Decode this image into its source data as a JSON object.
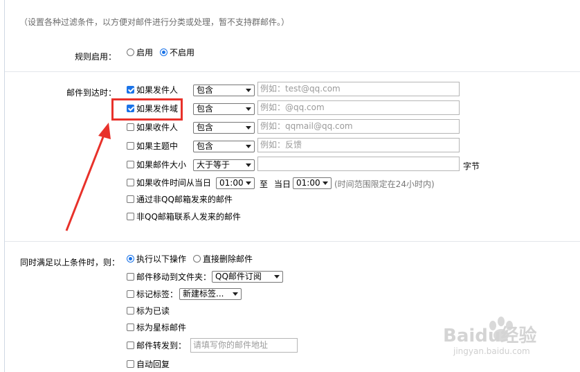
{
  "hint": "（设置各种过滤条件，以方便对邮件进行分类或处理，暂不支持群邮件。）",
  "rule_enable": {
    "label": "规则启用：",
    "on": "启用",
    "off": "不启用",
    "selected": "不启用"
  },
  "conditions": {
    "label": "邮件到达时：",
    "rows": [
      {
        "label": "如果发件人",
        "checked": true,
        "op": "包含",
        "placeholder": "例如：test@qq.com"
      },
      {
        "label": "如果发件域",
        "checked": true,
        "op": "包含",
        "placeholder": "例如：@qq.com"
      },
      {
        "label": "如果收件人",
        "checked": false,
        "op": "包含",
        "placeholder": "例如：qqmail@qq.com"
      },
      {
        "label": "如果主题中",
        "checked": false,
        "op": "包含",
        "placeholder": "例如：反馈"
      },
      {
        "label": "如果邮件大小",
        "checked": false,
        "op": "大于等于",
        "placeholder": "",
        "unit": "字节"
      }
    ],
    "time": {
      "label": "如果收件时间从当日",
      "from": "01:00",
      "to_label": "至",
      "day_label": "当日",
      "to": "01:00",
      "note": "(时间范围限定在24小时内)"
    },
    "non_qq": "通过非QQ邮箱发来的邮件",
    "non_contact": "非QQ邮箱联系人发来的邮件"
  },
  "actions": {
    "label": "同时满足以上条件时，则：",
    "exec": "执行以下操作",
    "delete": "直接删除邮件",
    "move": "邮件移动到文件夹：",
    "move_folder": "QQ邮件订阅",
    "tag": "标记标签：",
    "tag_value": "新建标签...",
    "read": "标为已读",
    "star": "标为星标邮件",
    "forward": "邮件转发到：",
    "forward_placeholder": "请填写你的邮件地址",
    "auto_reply": "自动回复"
  },
  "watermark": {
    "logo": "Baidu经验",
    "url": "jingyan.baidu.com"
  },
  "colors": {
    "accent": "#1a73e8",
    "highlight": "#e8312a"
  }
}
